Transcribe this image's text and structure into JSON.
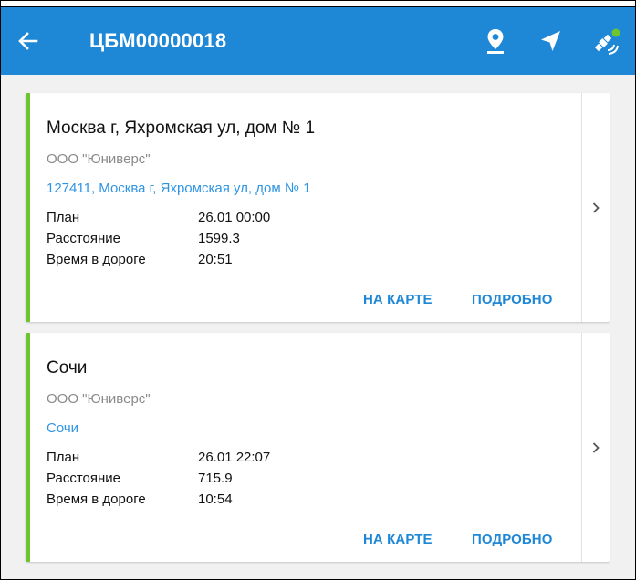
{
  "appbar": {
    "title": "ЦБМ00000018",
    "background": "#1e87d6",
    "icons": [
      "back-arrow-icon",
      "map-pin-icon",
      "navigation-arrow-icon",
      "satellite-icon"
    ]
  },
  "accent_color": "#6fc52d",
  "cards": [
    {
      "title": "Москва г, Яхромская ул, дом № 1",
      "organization": "ООО \"Юниверс\"",
      "address_link": "127411, Москва г, Яхромская ул, дом № 1",
      "rows": [
        {
          "label": "План",
          "value": "26.01 00:00"
        },
        {
          "label": "Расстояние",
          "value": "1599.3"
        },
        {
          "label": "Время в дороге",
          "value": "20:51"
        }
      ],
      "map_button": "НА КАРТЕ",
      "details_button": "ПОДРОБНО"
    },
    {
      "title": "Сочи",
      "organization": "ООО \"Юниверс\"",
      "address_link": "Сочи",
      "rows": [
        {
          "label": "План",
          "value": "26.01 22:07"
        },
        {
          "label": "Расстояние",
          "value": "715.9"
        },
        {
          "label": "Время в дороге",
          "value": "10:54"
        }
      ],
      "map_button": "НА КАРТЕ",
      "details_button": "ПОДРОБНО"
    }
  ]
}
